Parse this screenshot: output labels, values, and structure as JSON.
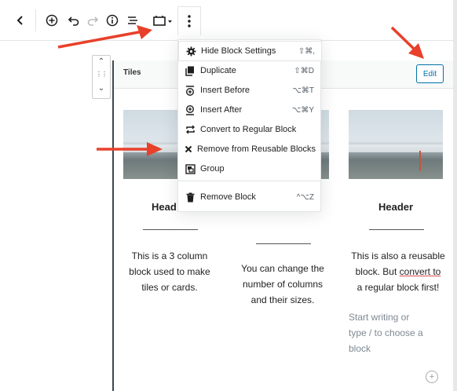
{
  "toolbar": {
    "back_icon": "chevron-left-icon",
    "add_icon": "plus-circle-icon",
    "undo_icon": "undo-icon",
    "redo_icon": "redo-icon",
    "info_icon": "info-icon",
    "outline_icon": "list-view-icon",
    "reusable_icon": "reusable-block-icon",
    "more_icon": "vertical-dots-icon"
  },
  "menu": {
    "items": [
      {
        "label": "Hide Block Settings",
        "shortcut": "⇧⌘,",
        "icon": "gear-icon"
      },
      {
        "label": "Duplicate",
        "shortcut": "⇧⌘D",
        "icon": "duplicate-icon"
      },
      {
        "label": "Insert Before",
        "shortcut": "⌥⌘T",
        "icon": "insert-before-icon"
      },
      {
        "label": "Insert After",
        "shortcut": "⌥⌘Y",
        "icon": "insert-after-icon"
      },
      {
        "label": "Convert to Regular Block",
        "shortcut": "",
        "icon": "convert-icon"
      },
      {
        "label": "Remove from Reusable Blocks",
        "shortcut": "",
        "icon": "close-icon"
      },
      {
        "label": "Group",
        "shortcut": "",
        "icon": "group-icon"
      },
      {
        "label": "Remove Block",
        "shortcut": "^⌥Z",
        "icon": "trash-icon"
      }
    ]
  },
  "block": {
    "title": "Tiles",
    "edit_label": "Edit"
  },
  "columns": [
    {
      "header": "Head",
      "text_lines": [
        "This is a 3 column",
        "block used to make",
        "tiles or cards."
      ]
    },
    {
      "header": "",
      "text_lines": [
        "You can change the",
        "number of columns",
        "and their sizes."
      ]
    },
    {
      "header": "Header",
      "line1": "This is also a reusable",
      "line2_pre": "block. But ",
      "line2_u": "convert  to",
      "line3": "a regular block first!"
    }
  ],
  "placeholder": {
    "lines": [
      "Start writing or",
      "type / to choose a",
      "block"
    ]
  },
  "colors": {
    "accent": "#0073aa",
    "annotation_arrow": "#e8402a"
  }
}
